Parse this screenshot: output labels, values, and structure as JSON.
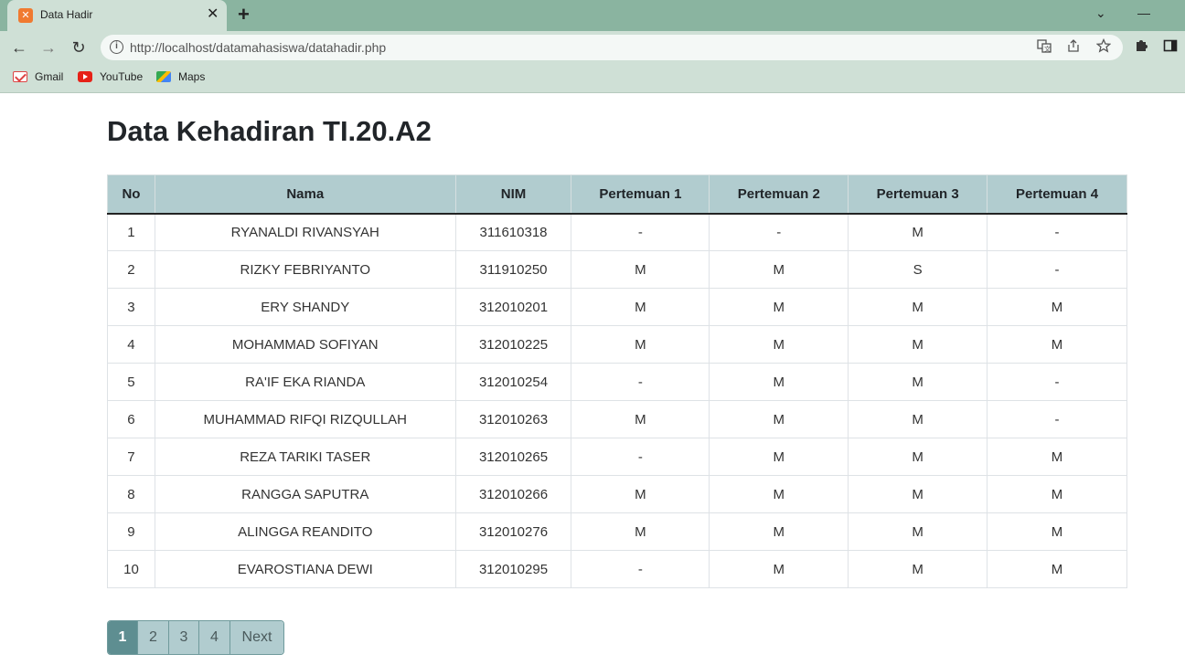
{
  "browser": {
    "tab": {
      "title": "Data Hadir",
      "close": "✕"
    },
    "new_tab": "+",
    "controls": {
      "dropdown": "⌄",
      "minimize": "—"
    },
    "nav": {
      "back": "←",
      "forward": "→",
      "reload": "↻"
    },
    "url": "http://localhost/datamahasiswa/datahadir.php",
    "bookmarks": [
      {
        "label": "Gmail",
        "icon": "gmail-icon"
      },
      {
        "label": "YouTube",
        "icon": "youtube-icon"
      },
      {
        "label": "Maps",
        "icon": "maps-icon"
      }
    ]
  },
  "page": {
    "title": "Data Kehadiran TI.20.A2"
  },
  "table": {
    "headers": [
      "No",
      "Nama",
      "NIM",
      "Pertemuan 1",
      "Pertemuan 2",
      "Pertemuan 3",
      "Pertemuan 4"
    ],
    "rows": [
      [
        "1",
        "RYANALDI RIVANSYAH",
        "311610318",
        "-",
        "-",
        "M",
        "-"
      ],
      [
        "2",
        "RIZKY FEBRIYANTO",
        "311910250",
        "M",
        "M",
        "S",
        "-"
      ],
      [
        "3",
        "ERY SHANDY",
        "312010201",
        "M",
        "M",
        "M",
        "M"
      ],
      [
        "4",
        "MOHAMMAD SOFIYAN",
        "312010225",
        "M",
        "M",
        "M",
        "M"
      ],
      [
        "5",
        "RA'IF EKA RIANDA",
        "312010254",
        "-",
        "M",
        "M",
        "-"
      ],
      [
        "6",
        "MUHAMMAD RIFQI RIZQULLAH",
        "312010263",
        "M",
        "M",
        "M",
        "-"
      ],
      [
        "7",
        "REZA TARIKI TASER",
        "312010265",
        "-",
        "M",
        "M",
        "M"
      ],
      [
        "8",
        "RANGGA SAPUTRA",
        "312010266",
        "M",
        "M",
        "M",
        "M"
      ],
      [
        "9",
        "ALINGGA REANDITO",
        "312010276",
        "M",
        "M",
        "M",
        "M"
      ],
      [
        "10",
        "EVAROSTIANA DEWI",
        "312010295",
        "-",
        "M",
        "M",
        "M"
      ]
    ]
  },
  "pagination": {
    "pages": [
      "1",
      "2",
      "3",
      "4"
    ],
    "next": "Next",
    "active_page": "1"
  },
  "colors": {
    "header_bg": "#b1cccf",
    "active_page_bg": "#5e8e91",
    "browser_frame": "#8ab4a0"
  }
}
